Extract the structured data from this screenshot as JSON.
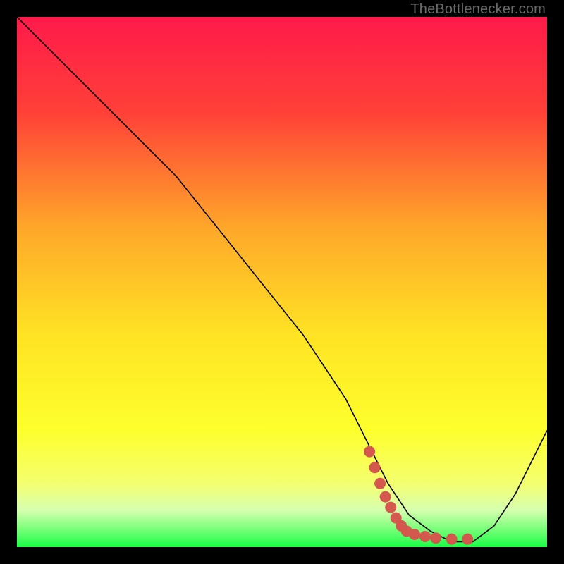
{
  "watermark": "TheBottlenecker.com",
  "chart_data": {
    "type": "line",
    "title": "",
    "xlabel": "",
    "ylabel": "",
    "xlim": [
      0,
      100
    ],
    "ylim": [
      0,
      100
    ],
    "background_gradient": {
      "stops": [
        {
          "offset": 0.0,
          "color": "#ff1a4b"
        },
        {
          "offset": 0.18,
          "color": "#ff4038"
        },
        {
          "offset": 0.4,
          "color": "#ffa82a"
        },
        {
          "offset": 0.6,
          "color": "#ffe324"
        },
        {
          "offset": 0.78,
          "color": "#fdff2d"
        },
        {
          "offset": 0.88,
          "color": "#f4ff6f"
        },
        {
          "offset": 0.93,
          "color": "#d7ffb0"
        },
        {
          "offset": 0.965,
          "color": "#7cff7c"
        },
        {
          "offset": 1.0,
          "color": "#1aff46"
        }
      ]
    },
    "series": [
      {
        "name": "bottleneck-curve",
        "color": "#000000",
        "width": 1.6,
        "x": [
          0,
          8,
          16,
          24,
          30,
          38,
          46,
          54,
          62,
          67,
          70,
          74,
          78,
          82,
          86,
          90,
          94,
          98,
          100
        ],
        "y": [
          100,
          92,
          84,
          76,
          70,
          60,
          50,
          40,
          28,
          18,
          12,
          6,
          3,
          1,
          1,
          4,
          10,
          18,
          22
        ]
      }
    ],
    "highlight": {
      "name": "optimal-zone",
      "color": "#d4584e",
      "marker_radius": 8,
      "points": [
        {
          "x": 66.5,
          "y": 18
        },
        {
          "x": 67.5,
          "y": 15
        },
        {
          "x": 68.5,
          "y": 12
        },
        {
          "x": 69.5,
          "y": 9.5
        },
        {
          "x": 70.5,
          "y": 7.5
        },
        {
          "x": 71.5,
          "y": 5.5
        },
        {
          "x": 72.5,
          "y": 4
        },
        {
          "x": 73.5,
          "y": 3
        },
        {
          "x": 75.0,
          "y": 2.4
        },
        {
          "x": 77.0,
          "y": 2.0
        },
        {
          "x": 79.0,
          "y": 1.7
        },
        {
          "x": 82.0,
          "y": 1.5
        },
        {
          "x": 85.0,
          "y": 1.5
        }
      ]
    }
  }
}
